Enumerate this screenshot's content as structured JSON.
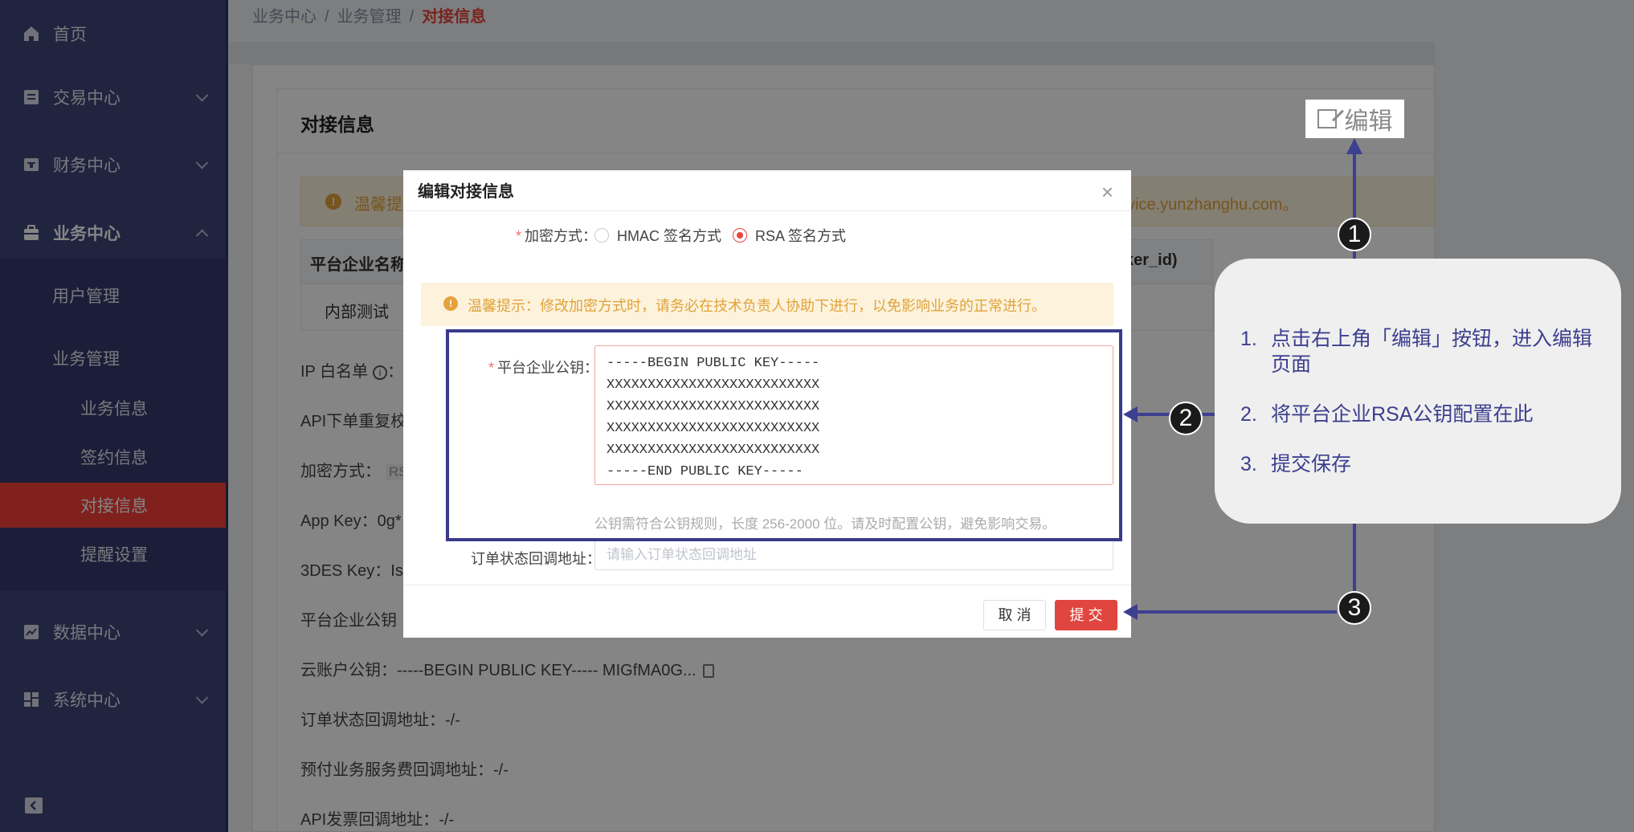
{
  "sidebar": {
    "items": [
      {
        "label": "首页",
        "icon": "home-icon"
      },
      {
        "label": "交易中心",
        "icon": "transaction-icon"
      },
      {
        "label": "财务中心",
        "icon": "finance-icon"
      },
      {
        "label": "业务中心",
        "icon": "briefcase-icon"
      },
      {
        "label": "数据中心",
        "icon": "chart-icon"
      },
      {
        "label": "系统中心",
        "icon": "grid-icon"
      }
    ],
    "sub_items": [
      "用户管理",
      "业务管理"
    ],
    "leaf_items": [
      "业务信息",
      "签约信息",
      "对接信息",
      "提醒设置"
    ]
  },
  "breadcrumb": {
    "first": "业务中心",
    "second": "业务管理",
    "current": "对接信息",
    "separator": "/"
  },
  "page": {
    "title": "对接信息",
    "warning_prefix": "温馨提",
    "warning_tail": "vice.yunzhanghu.com。",
    "table_head_1": "平台企业名称",
    "table_head_2": "ker_id)",
    "table_cell_1": "内部测试",
    "ip_whitelist": "IP 白名单",
    "ip_suffix": "：",
    "api_retry": "API下单重复校",
    "encryption_label": "加密方式：",
    "encryption_tag": "RS",
    "app_key": "App Key：0g*",
    "des_key": "3DES Key：Is",
    "platform_pubkey": "平台企业公钥",
    "cloud_pubkey": "云账户公钥：-----BEGIN PUBLIC KEY----- MIGfMA0G...",
    "order_callback": "订单状态回调地址：-/-",
    "prepay_callback": "预付业务服务费回调地址：-/-",
    "invoice_callback": "API发票回调地址：-/-"
  },
  "edit_button": {
    "label": "编辑"
  },
  "dialog": {
    "title": "编辑对接信息",
    "close": "×",
    "encryption_label": "加密方式：",
    "radio_hmac": "HMAC 签名方式",
    "radio_rsa": "RSA 签名方式",
    "selected": "RSA 签名方式",
    "warning": "温馨提示：修改加密方式时，请务必在技术负责人协助下进行，以免影响业务的正常进行。",
    "pubkey_label": "平台企业公钥：",
    "pubkey_value": "-----BEGIN PUBLIC KEY-----\nXXXXXXXXXXXXXXXXXXXXXXXXXX\nXXXXXXXXXXXXXXXXXXXXXXXXXX\nXXXXXXXXXXXXXXXXXXXXXXXXXX\nXXXXXXXXXXXXXXXXXXXXXXXXXX\n-----END PUBLIC KEY-----",
    "pubkey_hint": "公钥需符合公钥规则，长度 256-2000 位。请及时配置公钥，避免影响交易。",
    "callback_label": "订单状态回调地址：",
    "callback_placeholder": "请输入订单状态回调地址",
    "cancel": "取 消",
    "submit": "提 交"
  },
  "annotations": {
    "badges": [
      "1",
      "2",
      "3"
    ],
    "steps": [
      {
        "num": "1.",
        "text": "点击右上角「编辑」按钮，进入编辑页面"
      },
      {
        "num": "2.",
        "text": "将平台企业RSA公钥配置在此"
      },
      {
        "num": "3.",
        "text": "提交保存"
      }
    ],
    "color": "#3d3f8f"
  },
  "colors": {
    "sidebar": "#3f457a",
    "active": "#f5403a",
    "primary": "#e0463f",
    "warning": "#e0a33a"
  }
}
